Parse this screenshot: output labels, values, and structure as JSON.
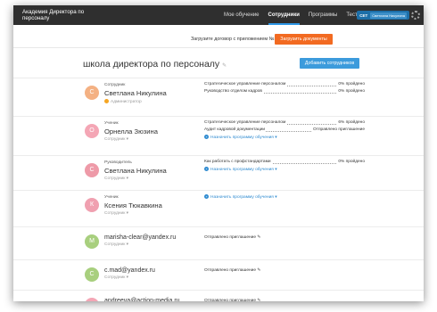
{
  "header": {
    "brand": "Академия Директора по персоналу",
    "nav": [
      "Мое обучение",
      "Сотрудники",
      "Программы",
      "Тесты"
    ],
    "active_nav": 1,
    "user_initials": "СЕТ",
    "user_name": "Светлана Никулина"
  },
  "banner": {
    "text": "Загрузите договор с приложением №1.",
    "button": "Загрузить документы"
  },
  "page": {
    "title": "школа директора по персоналу",
    "add_button": "Добавить сотрудников"
  },
  "employees": [
    {
      "initial": "С",
      "color": "#f4b183",
      "role": "Сотрудник",
      "name": "Светлана Никулина",
      "sub": "Администратор",
      "admin": true,
      "programs": [
        {
          "label": "Стратегическое управление персоналом",
          "status": "0% пройдено"
        },
        {
          "label": "Руководство отделом кадров",
          "status": "0% пройдено"
        }
      ],
      "assign": ""
    },
    {
      "initial": "О",
      "color": "#f4a6b5",
      "role": "Ученик",
      "name": "Орнелла Зюзина",
      "sub": "Сотрудник ▾",
      "admin": false,
      "programs": [
        {
          "label": "Стратегическое управление персоналом",
          "status": "6% пройдено"
        },
        {
          "label": "Аудит кадровой документации",
          "status": "Отправлено приглашение"
        }
      ],
      "assign": "Назначить программу обучения ▾"
    },
    {
      "initial": "С",
      "color": "#ee9aa8",
      "role": "Руководитель",
      "name": "Светлана Никулина",
      "sub": "Сотрудник ▾",
      "admin": false,
      "programs": [
        {
          "label": "Как работать с профстандартами",
          "status": "0% пройдено"
        }
      ],
      "assign": "Назначить программу обучения ▾"
    },
    {
      "initial": "К",
      "color": "#f0a0b0",
      "role": "Ученик",
      "name": "Ксения Тюкавкина",
      "sub": "Сотрудник ▾",
      "admin": false,
      "programs": [],
      "assign": "Назначить программу обучения ▾"
    },
    {
      "initial": "M",
      "color": "#a8cf7e",
      "role": "",
      "name": "marisha-clear@yandex.ru",
      "sub": "Сотрудник ▾",
      "admin": false,
      "programs": [],
      "assign": "",
      "invite": "Отправлено приглашение ✎"
    },
    {
      "initial": "C",
      "color": "#a8cf7e",
      "role": "",
      "name": "c.mad@yandex.ru",
      "sub": "Сотрудник ▾",
      "admin": false,
      "programs": [],
      "assign": "",
      "invite": "Отправлено приглашение ✎"
    },
    {
      "initial": "Ю",
      "color": "#f4a6b5",
      "role": "",
      "name": "andreeva@action-media.ru",
      "sub": "Сотрудник ▾",
      "admin": false,
      "programs": [],
      "assign": "",
      "invite": "Отправлено приглашение ✎"
    }
  ]
}
